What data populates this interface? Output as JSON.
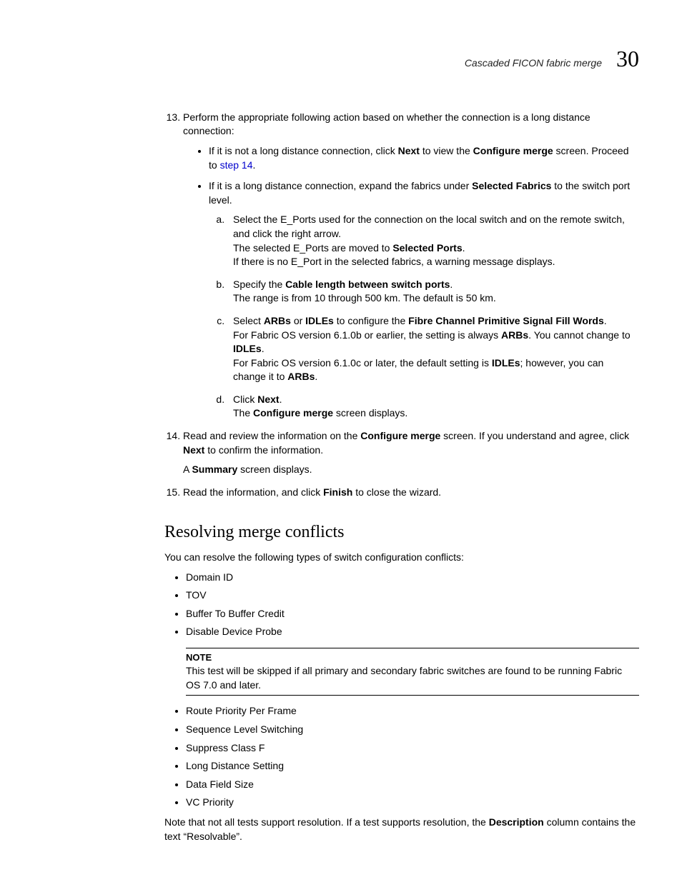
{
  "header": {
    "title": "Cascaded FICON fabric merge",
    "chapter_num": "30"
  },
  "step13": {
    "num": "13.",
    "intro": "Perform the appropriate following action based on whether the connection is a long distance connection:",
    "b1_a": "If it is not a long distance connection, click ",
    "b1_b": "Next",
    "b1_c": " to view the ",
    "b1_d": "Configure merge",
    "b1_e": " screen. Proceed to ",
    "b1_link": "step 14",
    "b1_f": ".",
    "b2_a": "If it is a long distance connection, expand the fabrics under ",
    "b2_b": "Selected Fabrics",
    "b2_c": " to the switch port level.",
    "a_line1": "Select the E_Ports used for the connection on the local switch and on the remote switch, and click the right arrow.",
    "a_line2a": "The selected E_Ports are moved to ",
    "a_line2b": "Selected Ports",
    "a_line2c": ".",
    "a_line3": "If there is no E_Port in the selected fabrics, a warning message displays.",
    "b_line1a": "Specify the ",
    "b_line1b": "Cable length between switch ports",
    "b_line1c": ".",
    "b_line2": "The range is from 10 through 500 km. The default is 50 km.",
    "c_l1a": "Select ",
    "c_l1b": "ARBs",
    "c_l1c": " or ",
    "c_l1d": "IDLEs",
    "c_l1e": " to configure the ",
    "c_l1f": "Fibre Channel Primitive Signal Fill Words",
    "c_l1g": ".",
    "c_l2a": "For Fabric OS version 6.1.0b or earlier, the setting is always ",
    "c_l2b": "ARBs",
    "c_l2c": ". You cannot change to ",
    "c_l2d": "IDLEs",
    "c_l2e": ".",
    "c_l3a": "For Fabric OS version 6.1.0c or later, the default setting is ",
    "c_l3b": "IDLEs",
    "c_l3c": "; however, you can change it to ",
    "c_l3d": "ARBs",
    "c_l3e": ".",
    "d_l1a": "Click ",
    "d_l1b": "Next",
    "d_l1c": ".",
    "d_l2a": "The ",
    "d_l2b": "Configure merge",
    "d_l2c": " screen displays."
  },
  "step14": {
    "l1a": "Read and review the information on the ",
    "l1b": "Configure merge",
    "l1c": " screen. If you understand and agree, click ",
    "l1d": "Next",
    "l1e": " to confirm the information.",
    "l2a": "A ",
    "l2b": "Summary",
    "l2c": " screen displays."
  },
  "step15": {
    "a": "Read the information, and click ",
    "b": "Finish",
    "c": " to close the wizard."
  },
  "section": {
    "title": "Resolving merge conflicts",
    "intro": "You can resolve the following types of switch configuration conflicts:",
    "list1": {
      "i0": "Domain ID",
      "i1": "TOV",
      "i2": "Buffer To Buffer Credit",
      "i3": "Disable Device Probe"
    },
    "note_label": "NOTE",
    "note_body": "This test will be skipped if all primary and secondary fabric switches are found to be running Fabric OS 7.0 and later.",
    "list2": {
      "i0": "Route Priority Per Frame",
      "i1": "Sequence Level Switching",
      "i2": "Suppress Class F",
      "i3": "Long Distance Setting",
      "i4": "Data Field Size",
      "i5": "VC Priority"
    },
    "closing_a": "Note that not all tests support resolution. If a test supports resolution, the ",
    "closing_b": "Description",
    "closing_c": " column contains the text “Resolvable”."
  }
}
